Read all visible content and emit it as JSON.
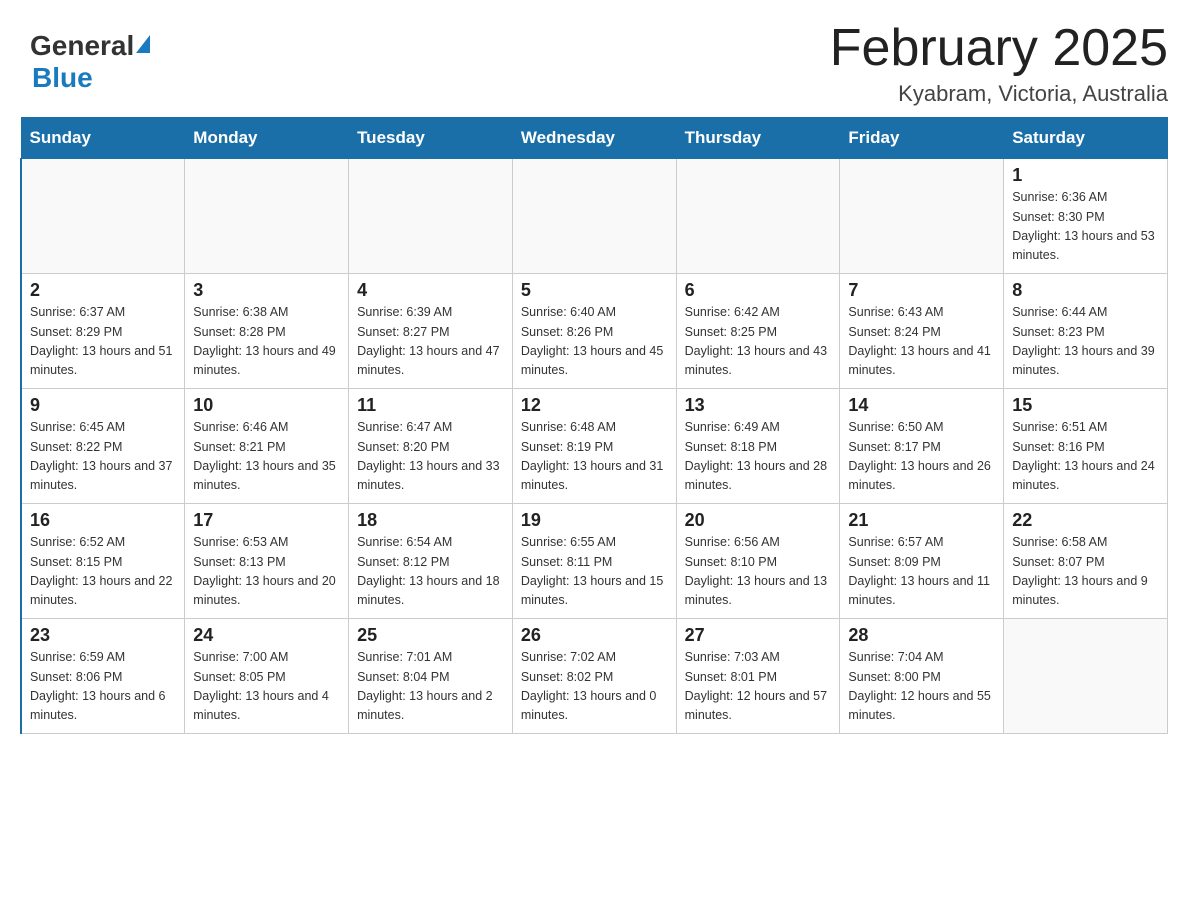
{
  "header": {
    "logo": {
      "general": "General",
      "blue": "Blue"
    },
    "title": "February 2025",
    "subtitle": "Kyabram, Victoria, Australia"
  },
  "days_of_week": [
    "Sunday",
    "Monday",
    "Tuesday",
    "Wednesday",
    "Thursday",
    "Friday",
    "Saturday"
  ],
  "weeks": [
    {
      "days": [
        {
          "num": "",
          "info": ""
        },
        {
          "num": "",
          "info": ""
        },
        {
          "num": "",
          "info": ""
        },
        {
          "num": "",
          "info": ""
        },
        {
          "num": "",
          "info": ""
        },
        {
          "num": "",
          "info": ""
        },
        {
          "num": "1",
          "info": "Sunrise: 6:36 AM\nSunset: 8:30 PM\nDaylight: 13 hours and 53 minutes."
        }
      ]
    },
    {
      "days": [
        {
          "num": "2",
          "info": "Sunrise: 6:37 AM\nSunset: 8:29 PM\nDaylight: 13 hours and 51 minutes."
        },
        {
          "num": "3",
          "info": "Sunrise: 6:38 AM\nSunset: 8:28 PM\nDaylight: 13 hours and 49 minutes."
        },
        {
          "num": "4",
          "info": "Sunrise: 6:39 AM\nSunset: 8:27 PM\nDaylight: 13 hours and 47 minutes."
        },
        {
          "num": "5",
          "info": "Sunrise: 6:40 AM\nSunset: 8:26 PM\nDaylight: 13 hours and 45 minutes."
        },
        {
          "num": "6",
          "info": "Sunrise: 6:42 AM\nSunset: 8:25 PM\nDaylight: 13 hours and 43 minutes."
        },
        {
          "num": "7",
          "info": "Sunrise: 6:43 AM\nSunset: 8:24 PM\nDaylight: 13 hours and 41 minutes."
        },
        {
          "num": "8",
          "info": "Sunrise: 6:44 AM\nSunset: 8:23 PM\nDaylight: 13 hours and 39 minutes."
        }
      ]
    },
    {
      "days": [
        {
          "num": "9",
          "info": "Sunrise: 6:45 AM\nSunset: 8:22 PM\nDaylight: 13 hours and 37 minutes."
        },
        {
          "num": "10",
          "info": "Sunrise: 6:46 AM\nSunset: 8:21 PM\nDaylight: 13 hours and 35 minutes."
        },
        {
          "num": "11",
          "info": "Sunrise: 6:47 AM\nSunset: 8:20 PM\nDaylight: 13 hours and 33 minutes."
        },
        {
          "num": "12",
          "info": "Sunrise: 6:48 AM\nSunset: 8:19 PM\nDaylight: 13 hours and 31 minutes."
        },
        {
          "num": "13",
          "info": "Sunrise: 6:49 AM\nSunset: 8:18 PM\nDaylight: 13 hours and 28 minutes."
        },
        {
          "num": "14",
          "info": "Sunrise: 6:50 AM\nSunset: 8:17 PM\nDaylight: 13 hours and 26 minutes."
        },
        {
          "num": "15",
          "info": "Sunrise: 6:51 AM\nSunset: 8:16 PM\nDaylight: 13 hours and 24 minutes."
        }
      ]
    },
    {
      "days": [
        {
          "num": "16",
          "info": "Sunrise: 6:52 AM\nSunset: 8:15 PM\nDaylight: 13 hours and 22 minutes."
        },
        {
          "num": "17",
          "info": "Sunrise: 6:53 AM\nSunset: 8:13 PM\nDaylight: 13 hours and 20 minutes."
        },
        {
          "num": "18",
          "info": "Sunrise: 6:54 AM\nSunset: 8:12 PM\nDaylight: 13 hours and 18 minutes."
        },
        {
          "num": "19",
          "info": "Sunrise: 6:55 AM\nSunset: 8:11 PM\nDaylight: 13 hours and 15 minutes."
        },
        {
          "num": "20",
          "info": "Sunrise: 6:56 AM\nSunset: 8:10 PM\nDaylight: 13 hours and 13 minutes."
        },
        {
          "num": "21",
          "info": "Sunrise: 6:57 AM\nSunset: 8:09 PM\nDaylight: 13 hours and 11 minutes."
        },
        {
          "num": "22",
          "info": "Sunrise: 6:58 AM\nSunset: 8:07 PM\nDaylight: 13 hours and 9 minutes."
        }
      ]
    },
    {
      "days": [
        {
          "num": "23",
          "info": "Sunrise: 6:59 AM\nSunset: 8:06 PM\nDaylight: 13 hours and 6 minutes."
        },
        {
          "num": "24",
          "info": "Sunrise: 7:00 AM\nSunset: 8:05 PM\nDaylight: 13 hours and 4 minutes."
        },
        {
          "num": "25",
          "info": "Sunrise: 7:01 AM\nSunset: 8:04 PM\nDaylight: 13 hours and 2 minutes."
        },
        {
          "num": "26",
          "info": "Sunrise: 7:02 AM\nSunset: 8:02 PM\nDaylight: 13 hours and 0 minutes."
        },
        {
          "num": "27",
          "info": "Sunrise: 7:03 AM\nSunset: 8:01 PM\nDaylight: 12 hours and 57 minutes."
        },
        {
          "num": "28",
          "info": "Sunrise: 7:04 AM\nSunset: 8:00 PM\nDaylight: 12 hours and 55 minutes."
        },
        {
          "num": "",
          "info": ""
        }
      ]
    }
  ]
}
